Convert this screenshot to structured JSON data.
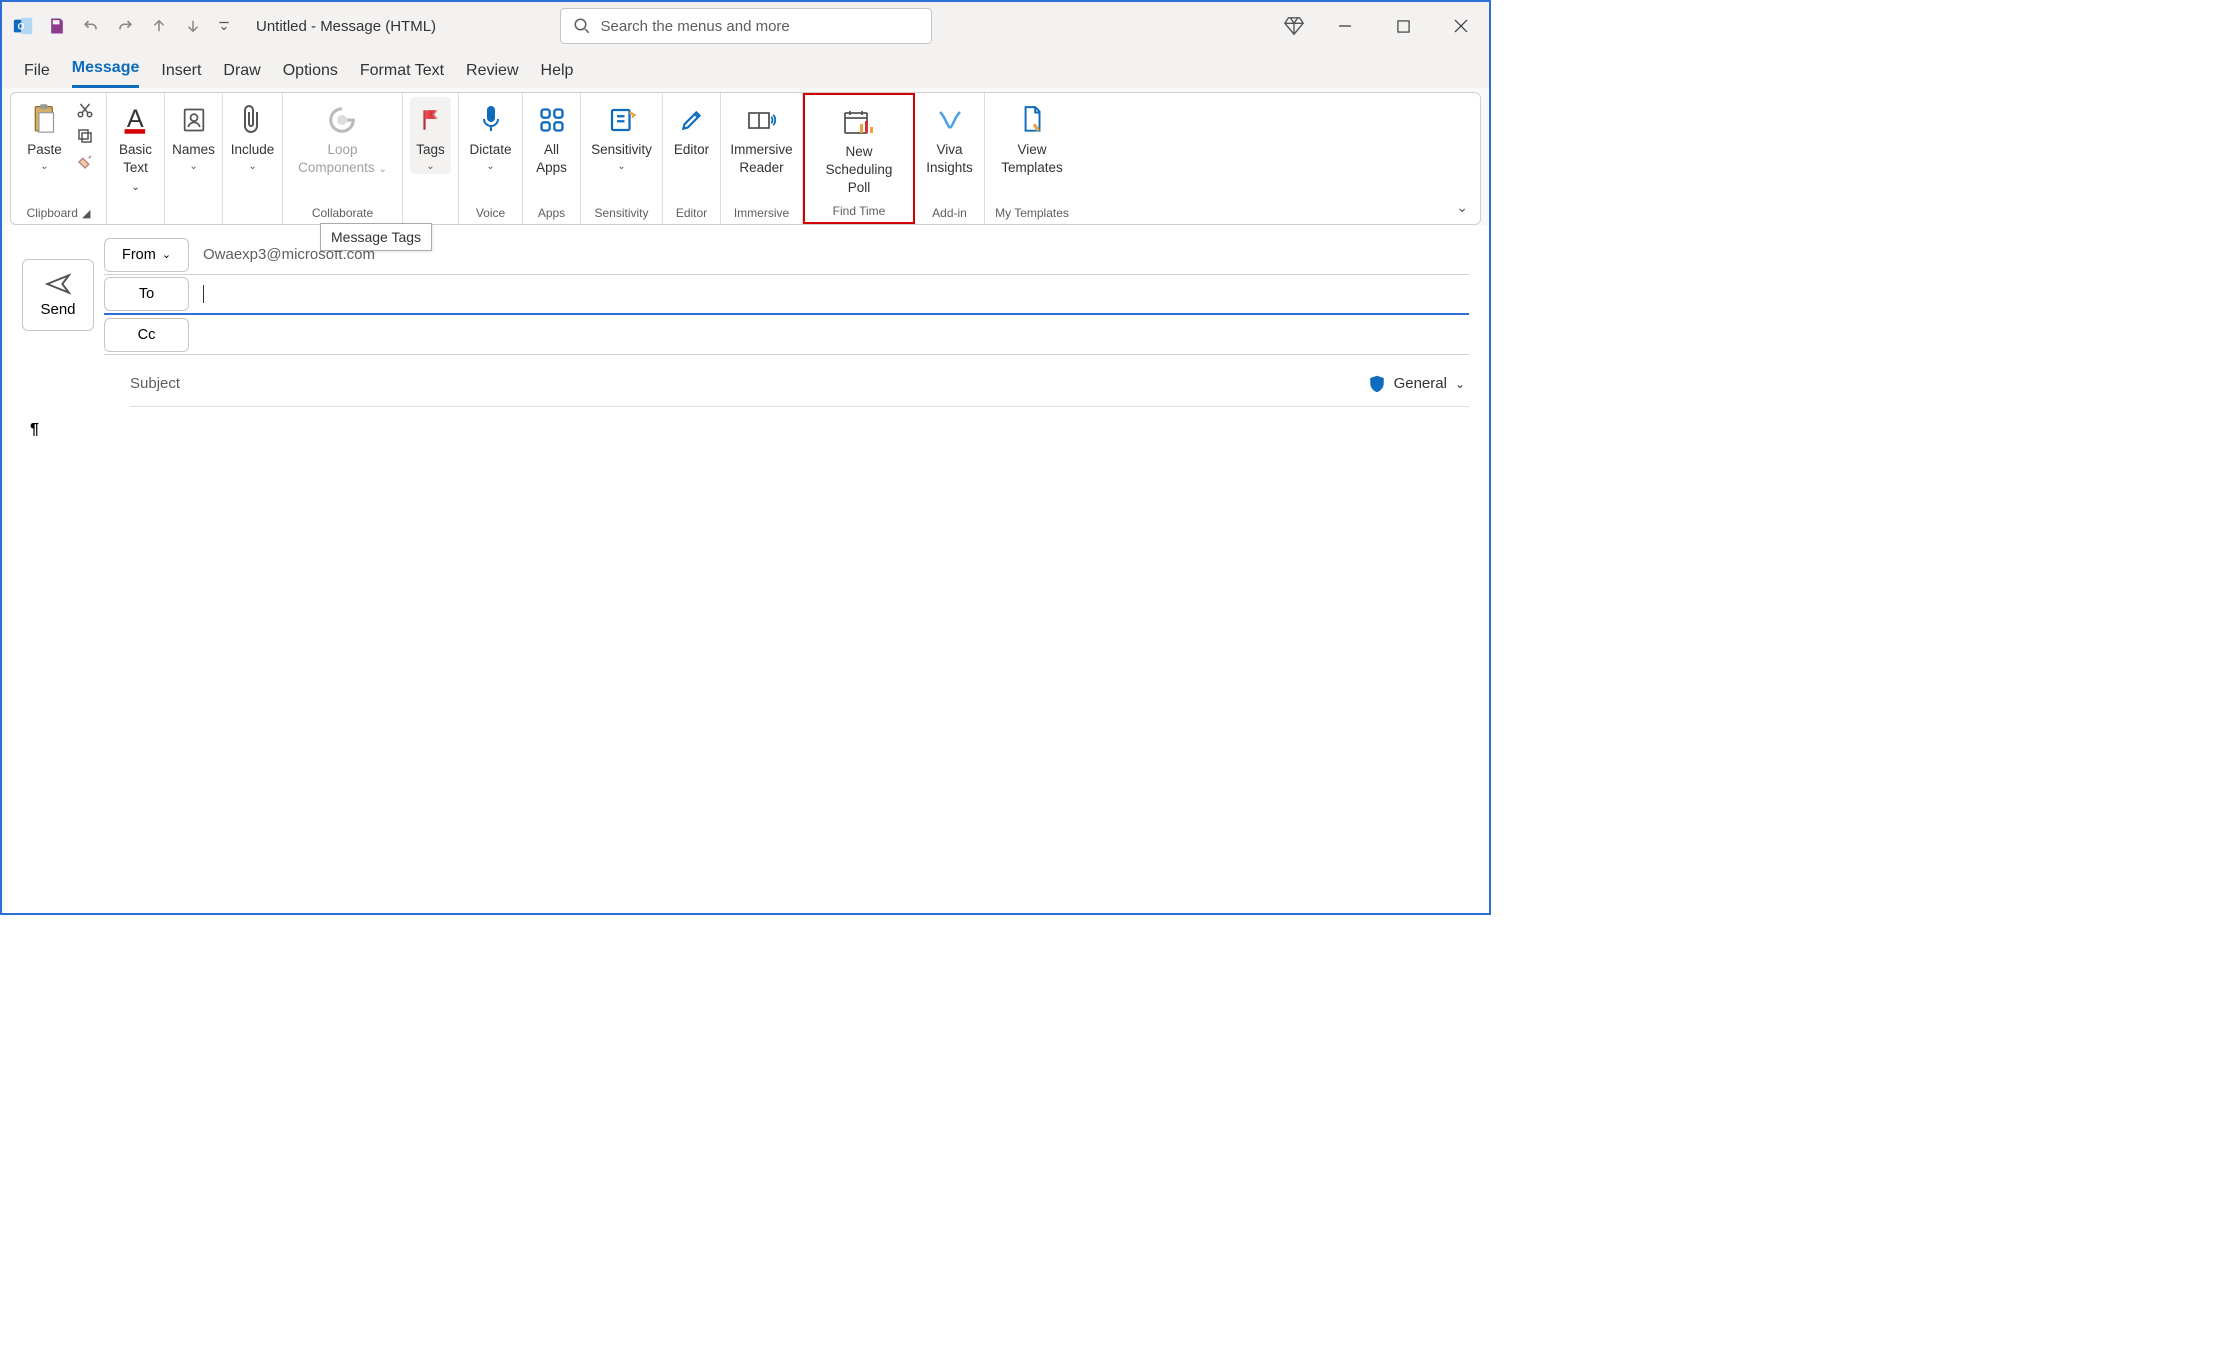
{
  "title": "Untitled  -  Message (HTML)",
  "search_placeholder": "Search the menus and more",
  "tabs": {
    "file": "File",
    "message": "Message",
    "insert": "Insert",
    "draw": "Draw",
    "options": "Options",
    "format": "Format Text",
    "review": "Review",
    "help": "Help"
  },
  "ribbon": {
    "clipboard": {
      "paste": "Paste",
      "label": "Clipboard"
    },
    "basic": {
      "label_line1": "Basic",
      "label_line2": "Text"
    },
    "names": {
      "label": "Names"
    },
    "include": {
      "label": "Include"
    },
    "loop": {
      "label_line1": "Loop",
      "label_line2": "Components",
      "group": "Collaborate"
    },
    "tags": {
      "label": "Tags",
      "tooltip": "Message Tags"
    },
    "dictate": {
      "label": "Dictate",
      "group": "Voice"
    },
    "apps": {
      "label_line1": "All",
      "label_line2": "Apps",
      "group": "Apps"
    },
    "sensitivity": {
      "label": "Sensitivity",
      "group": "Sensitivity"
    },
    "editor": {
      "label": "Editor",
      "group": "Editor"
    },
    "immersive": {
      "label_line1": "Immersive",
      "label_line2": "Reader",
      "group": "Immersive"
    },
    "scheduling": {
      "label_line1": "New",
      "label_line2": "Scheduling Poll",
      "group": "Find Time"
    },
    "viva": {
      "label_line1": "Viva",
      "label_line2": "Insights",
      "group": "Add-in"
    },
    "templates": {
      "label_line1": "View",
      "label_line2": "Templates",
      "group": "My Templates"
    }
  },
  "compose": {
    "send": "Send",
    "from": "From",
    "to": "To",
    "cc": "Cc",
    "subject": "Subject",
    "from_value": "Owaexp3@microsoft.com",
    "sensitivity_label": "General",
    "body": "¶"
  }
}
